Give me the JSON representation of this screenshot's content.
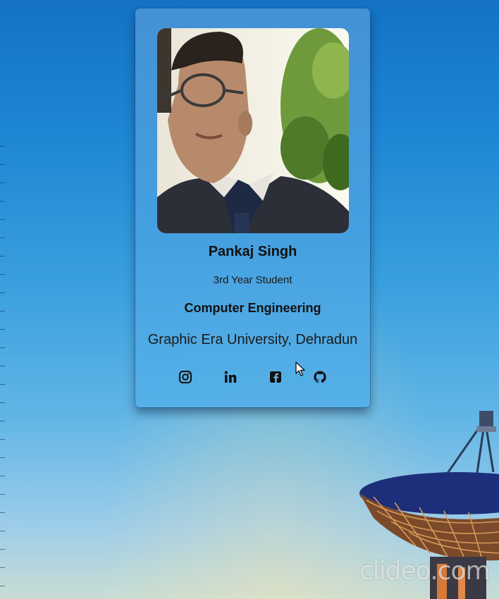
{
  "profile": {
    "name": "Pankaj Singh",
    "year": "3rd Year Student",
    "department": "Computer Engineering",
    "university": "Graphic Era University, Dehradun",
    "photo_alt": "Profile photo"
  },
  "social": [
    {
      "name": "instagram",
      "icon": "instagram-icon"
    },
    {
      "name": "linkedin",
      "icon": "linkedin-icon"
    },
    {
      "name": "facebook",
      "icon": "facebook-icon"
    },
    {
      "name": "github",
      "icon": "github-icon"
    }
  ],
  "watermark": "clideo.com",
  "colors": {
    "card": "#4a9ed8",
    "text": "#111111",
    "sky_top": "#1372c4",
    "sky_bottom": "#c9ddd4"
  }
}
